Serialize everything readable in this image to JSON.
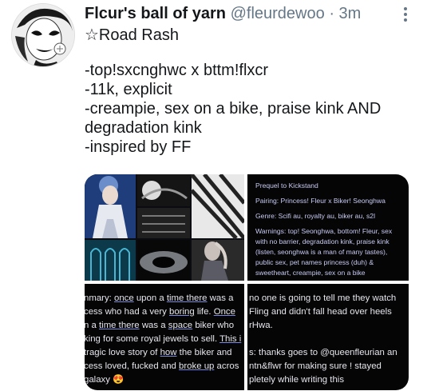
{
  "tweet": {
    "display_name": "Flcur's ball of yarn",
    "handle": "@fleurdewoo",
    "separator": "·",
    "timestamp": "3m",
    "more_icon": "more-vertical-icon",
    "text_lines": [
      "☆Road Rash",
      "",
      "-top!sxcnghwc x bttm!flxcr",
      "-11k, explicit",
      "-creampie, sex on a bike, praise kink AND",
      "degradation kink",
      "-inspired by FF"
    ]
  },
  "media": {
    "moodboard_icon": "moodboard-collage-image",
    "notes": {
      "prequel": "Prequel to Kickstand",
      "pairing": "Pairing: Princess! Fleur x Biker! Seonghwa",
      "genre": "Genre: Scifi au, royalty au, biker au, s2l",
      "warnings_lines": [
        "Warnings: top! Seonghwa, bottom! Fleur, sex",
        "with no barrier, degradation kink, praise kink",
        "(listen, seonghwa is a man of many tastes),",
        "public sex, pet names princess (duh) &",
        "sweetheart, creampie, sex on a bike"
      ]
    },
    "summary": {
      "l1_a": "nmary: ",
      "l1_b": "once",
      "l1_c": " upon a ",
      "l1_d": "time there",
      "l1_e": " was a",
      "l2_a": "cess who had a very ",
      "l2_b": "boring",
      "l2_c": " life. ",
      "l2_d": "Once",
      "l3_a": "n a ",
      "l3_b": "time there",
      "l3_c": " was a ",
      "l3_d": "space",
      "l3_e": " biker who",
      "l4_a": "king for some royal jewels to sell. ",
      "l4_b": "This i",
      "l5_a": " tragic love story of ",
      "l5_b": "how",
      "l5_c": " the biker and",
      "l6_a": "cess loved, fucked and ",
      "l6_b": "broke up",
      "l6_c": " acros",
      "l7_a": "galaxy ",
      "l7_emoji": "😍"
    },
    "ack": {
      "l1": "no one is going to tell me they watch",
      "l2": "Fling and didn't fall head over heels",
      "l3": "rHwa.",
      "l4": "s: thanks goes to @queenfleurian an",
      "l5": "ntn&flwr for making sure ! stayed",
      "l6": "pletely while writing this"
    },
    "colors": {
      "note_text": "#c8cbf4",
      "panel_bg": "#050505",
      "link_underline": "#7b8ce0"
    }
  }
}
